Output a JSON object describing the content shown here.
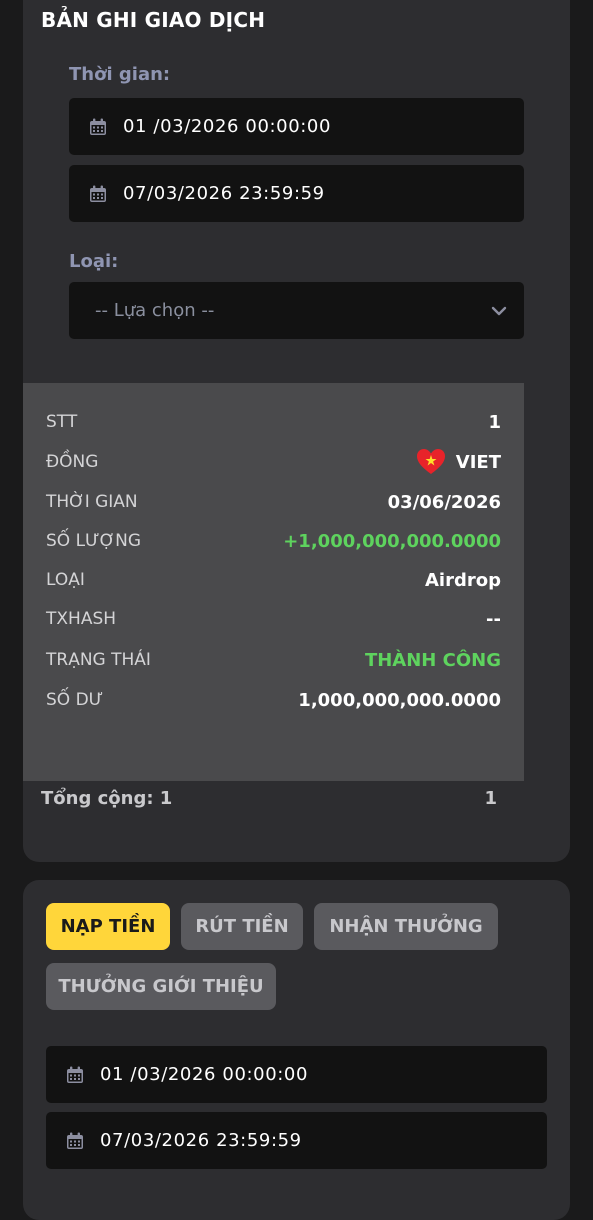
{
  "section1": {
    "title": "BẢN GHI GIAO DỊCH",
    "time_label": "Thời gian:",
    "start_date": "01 /03/2026 00:00:00",
    "end_date": "07/03/2026 23:59:59",
    "type_label": "Loại:",
    "type_placeholder": "-- Lựa chọn --"
  },
  "record": {
    "rows": [
      {
        "key": "STT",
        "value": "1"
      },
      {
        "key": "ĐỒNG",
        "value": "VIET"
      },
      {
        "key": "THỜI GIAN",
        "value": "03/06/2026"
      },
      {
        "key": "SỐ LƯỢNG",
        "value": "+1,000,000,000.0000"
      },
      {
        "key": "LOẠI",
        "value": "Airdrop"
      },
      {
        "key": "TXHASH",
        "value": "--"
      },
      {
        "key": "TRẠNG THÁI",
        "value": "THÀNH CÔNG"
      },
      {
        "key": "SỐ DƯ",
        "value": "1,000,000,000.0000"
      }
    ]
  },
  "total": {
    "label": "Tổng cộng: 1",
    "value": "1"
  },
  "section2": {
    "tabs": [
      "NẠP TIỀN",
      "RÚT TIỀN",
      "NHẬN THƯỞNG",
      "THƯỞNG GIỚI THIỆU"
    ],
    "start_date": "01 /03/2026 00:00:00",
    "end_date": "07/03/2026 23:59:59"
  },
  "colors": {
    "accent": "#ffd63a",
    "success": "#5ed35e",
    "card": "#2d2d30",
    "field": "#121212"
  },
  "icons": {
    "date_field": "calendar-icon",
    "select": "chevron-down-icon",
    "coin": "vietnam-flag-heart-icon"
  }
}
